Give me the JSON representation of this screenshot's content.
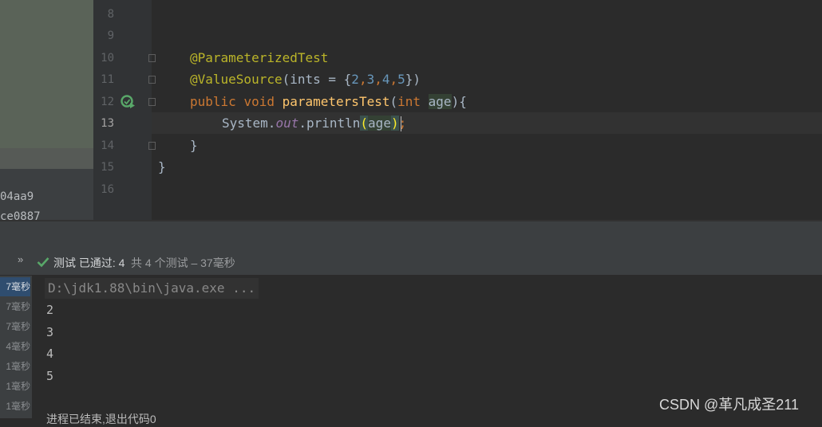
{
  "project_panel": {
    "commit_1": "04aa9",
    "commit_2": "ce0887"
  },
  "editor": {
    "line_numbers": [
      "8",
      "9",
      "10",
      "11",
      "12",
      "13",
      "14",
      "15",
      "16"
    ],
    "current_line": "13",
    "code": {
      "l10_annotation": "@ParameterizedTest",
      "l11_annotation": "@ValueSource",
      "l11_open": "(ints = {",
      "l11_n1": "2",
      "l11_c1": ",",
      "l11_n2": "3",
      "l11_c2": ",",
      "l11_n3": "4",
      "l11_c3": ",",
      "l11_n4": "5",
      "l11_close": "})",
      "l12_public": "public",
      "l12_void": "void",
      "l12_method": "parametersTest",
      "l12_open": "(",
      "l12_int": "int",
      "l12_param": "age",
      "l12_close": "){",
      "l13_system": "System.",
      "l13_out": "out",
      "l13_println": ".println",
      "l13_paren_open": "(",
      "l13_arg": "age",
      "l13_paren_close": ")",
      "l13_semi": ";",
      "l14_brace": "}",
      "l15_brace": "}"
    }
  },
  "test_status": {
    "expand_glyph": "»",
    "check_icon": "check-icon",
    "label": "测试 已通过: 4",
    "summary": "共 4 个测试 – 37毫秒"
  },
  "test_tree": {
    "durations": [
      "7毫秒",
      "7毫秒",
      "7毫秒",
      "4毫秒",
      "1毫秒",
      "1毫秒",
      "1毫秒"
    ]
  },
  "console": {
    "command": "D:\\jdk1.88\\bin\\java.exe ...",
    "output": [
      "2",
      "3",
      "4",
      "5"
    ],
    "exit_message": "进程已结束,退出代码0"
  },
  "watermark": "CSDN @革凡成圣211",
  "colors": {
    "editor_bg": "#2b2b2b",
    "panel_bg": "#3c3f41",
    "annotation": "#bbb529",
    "keyword": "#cc7832",
    "number": "#6897bb",
    "method": "#ffc66d",
    "check": "#59a869"
  }
}
